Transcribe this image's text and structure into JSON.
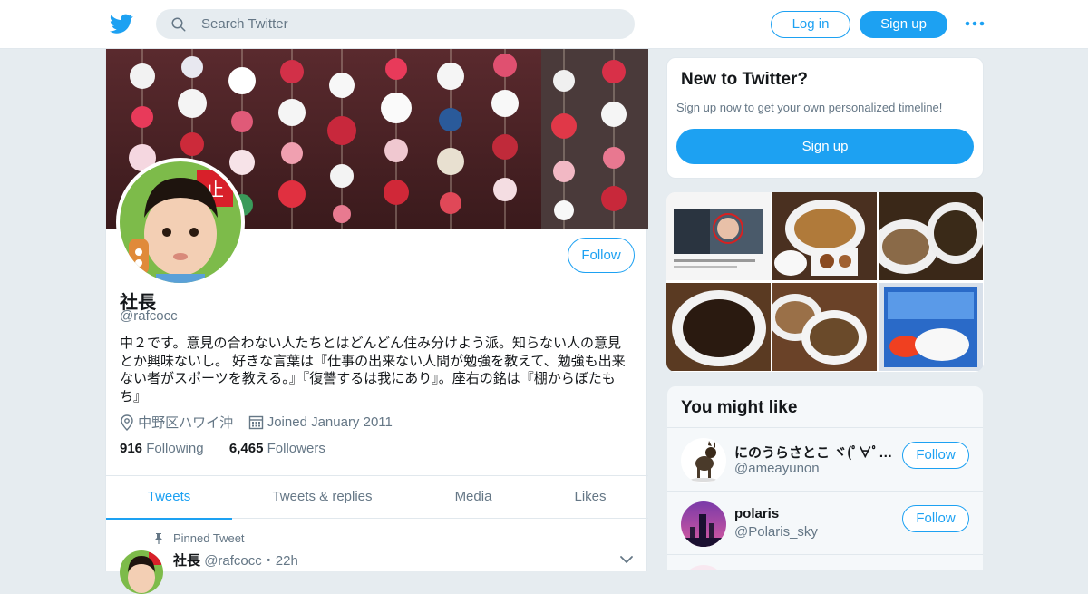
{
  "header": {
    "search_placeholder": "Search Twitter",
    "login_label": "Log in",
    "signup_label": "Sign up",
    "brand_color": "#1da1f2"
  },
  "profile": {
    "name": "社長",
    "handle": "@rafcocc",
    "follow_label": "Follow",
    "bio": "中２です。意見の合わない人たちとはどんどん住み分けよう派。知らない人の意見とか興味ないし。 好きな言葉は『仕事の出来ない人間が勉強を教えて、勉強も出来ない者がスポーツを教える。』『復讐するは我にあり』。座右の銘は『棚からぼたもち』",
    "location": "中野区ハワイ沖",
    "joined": "Joined January 2011",
    "following_count": "916",
    "following_label": "Following",
    "followers_count": "6,465",
    "followers_label": "Followers"
  },
  "tabs": [
    {
      "label": "Tweets",
      "active": true
    },
    {
      "label": "Tweets & replies",
      "active": false
    },
    {
      "label": "Media",
      "active": false
    },
    {
      "label": "Likes",
      "active": false
    }
  ],
  "pinned_tweet": {
    "pinned_label": "Pinned Tweet",
    "name": "社長",
    "handle": "@rafcocc",
    "separator": "・",
    "time": "22h"
  },
  "new_to_twitter": {
    "heading": "New to Twitter?",
    "subtitle": "Sign up now to get your own personalized timeline!",
    "signup_label": "Sign up"
  },
  "you_might_like": {
    "heading": "You might like",
    "accounts": [
      {
        "name": "にのうらさとこ ヾ(ﾟ∀ﾟ○…",
        "handle": "@ameayunon",
        "follow_label": "Follow"
      },
      {
        "name": "polaris",
        "handle": "@Polaris_sky",
        "follow_label": "Follow"
      }
    ]
  }
}
